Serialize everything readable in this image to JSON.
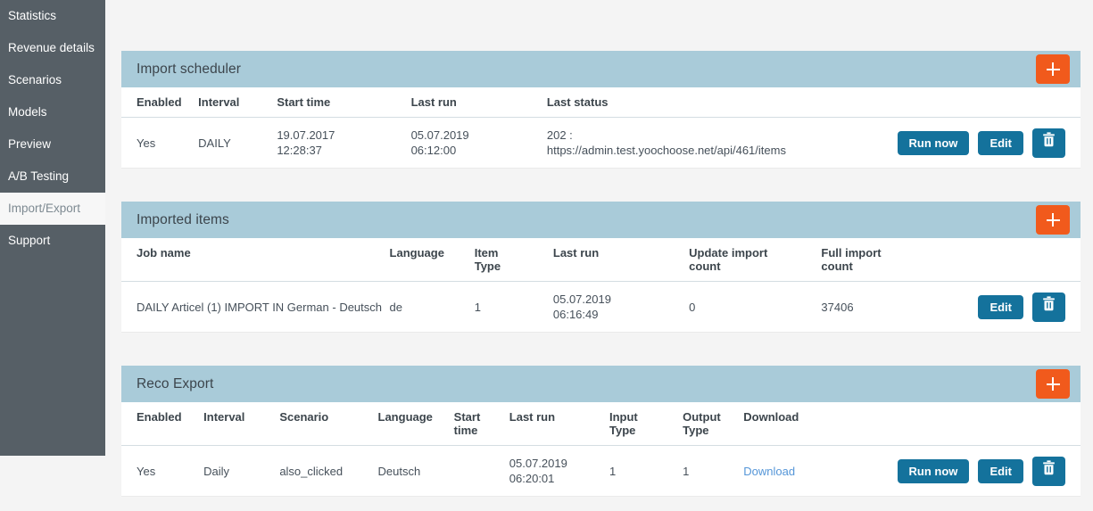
{
  "sidebar": {
    "items": [
      {
        "label": "Statistics",
        "active": false
      },
      {
        "label": "Revenue details",
        "active": false
      },
      {
        "label": "Scenarios",
        "active": false
      },
      {
        "label": "Models",
        "active": false
      },
      {
        "label": "Preview",
        "active": false
      },
      {
        "label": "A/B Testing",
        "active": false
      },
      {
        "label": "Import/Export",
        "active": true
      },
      {
        "label": "Support",
        "active": false
      }
    ]
  },
  "colors": {
    "sidebar_bg": "#565f66",
    "panel_header_bg": "#a9cbd9",
    "accent_orange": "#f15a1c",
    "button_blue": "#14729c",
    "link_blue": "#5596d8",
    "page_bg": "#f4f4f4"
  },
  "panels": [
    {
      "title": "Import scheduler",
      "add_button_label": "+",
      "columns": [
        "Enabled",
        "Interval",
        "Start time",
        "Last run",
        "Last status"
      ],
      "rows": [
        {
          "enabled": "Yes",
          "interval": "DAILY",
          "start_time": "19.07.2017\n12:28:37",
          "last_run": "05.07.2019\n06:12:00",
          "last_status": "202 :\nhttps://admin.test.yoochoose.net/api/461/items",
          "actions": [
            "Run now",
            "Edit",
            "delete"
          ]
        }
      ]
    },
    {
      "title": "Imported items",
      "add_button_label": "+",
      "columns": [
        "Job name",
        "Language",
        "Item\nType",
        "Last run",
        "Update import\ncount",
        "Full import\ncount"
      ],
      "rows": [
        {
          "job_name": "DAILY Articel (1) IMPORT IN German - Deutsch",
          "language": "de",
          "item_type": "1",
          "last_run": "05.07.2019\n06:16:49",
          "update_import_count": "0",
          "full_import_count": "37406",
          "actions": [
            "Edit",
            "delete"
          ]
        }
      ]
    },
    {
      "title": "Reco Export",
      "add_button_label": "+",
      "columns": [
        "Enabled",
        "Interval",
        "Scenario",
        "Language",
        "Start\ntime",
        "Last run",
        "Input\nType",
        "Output\nType",
        "Download"
      ],
      "rows": [
        {
          "enabled": "Yes",
          "interval": "Daily",
          "scenario": "also_clicked",
          "language": "Deutsch",
          "start_time": "",
          "last_run": "05.07.2019\n06:20:01",
          "input_type": "1",
          "output_type": "1",
          "download_label": "Download",
          "actions": [
            "Run now",
            "Edit",
            "delete"
          ]
        }
      ]
    }
  ],
  "buttons": {
    "run_now": "Run now",
    "edit": "Edit",
    "delete_title": "Delete"
  }
}
